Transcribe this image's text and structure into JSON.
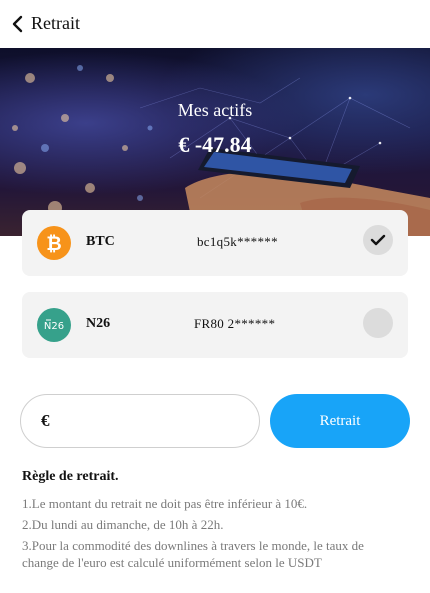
{
  "header": {
    "title": "Retrait"
  },
  "banner": {
    "label": "Mes actifs",
    "balance": "€ -47.84"
  },
  "accounts": [
    {
      "name": "BTC",
      "address": "bc1q5k******",
      "selected": true,
      "icon": "bitcoin-icon",
      "color": "#f7931a"
    },
    {
      "name": "N26",
      "address": "FR80 2******",
      "selected": false,
      "icon": "n26-icon",
      "color": "#36a18b",
      "icon_text": "N26"
    }
  ],
  "amount": {
    "currency": "€",
    "value": "",
    "placeholder": ""
  },
  "withdraw_button": {
    "label": "Retrait",
    "color": "#18a4f8"
  },
  "rules": {
    "title": "Règle de retrait.",
    "items": [
      "1.Le montant du retrait ne doit pas être inférieur à 10€.",
      "2.Du lundi au dimanche, de 10h à 22h.",
      "3.Pour la commodité des downlines à travers le monde, le taux de change de l'euro est calculé uniformément selon le USDT"
    ]
  }
}
